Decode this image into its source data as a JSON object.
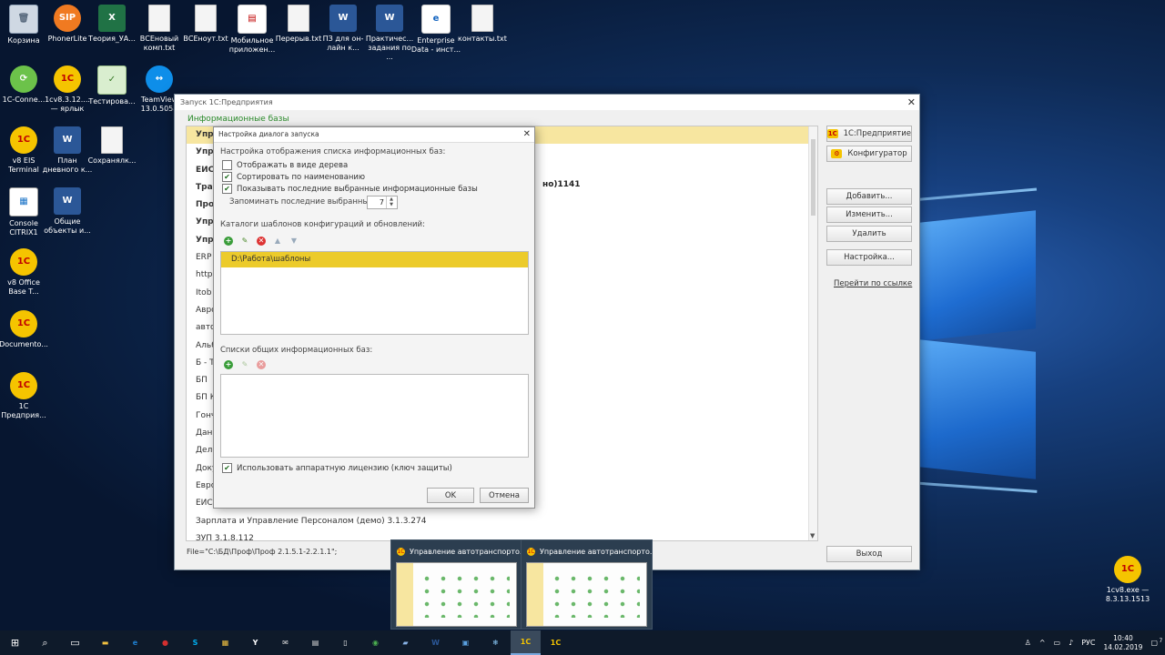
{
  "desktop": {
    "icons": [
      {
        "label": "Корзина",
        "icon": "recycle-bin-icon",
        "glyph": "🗑"
      },
      {
        "label": "PhonerLite",
        "icon": "phonerlite-icon",
        "glyph": "SIP"
      },
      {
        "label": "Теория_УА...",
        "icon": "excel-file-icon",
        "glyph": "X"
      },
      {
        "label": "ВСЕновый комп.txt",
        "icon": "text-file-icon",
        "glyph": ""
      },
      {
        "label": "ВСЕноут.txt",
        "icon": "text-file-icon",
        "glyph": ""
      },
      {
        "label": "Мобильное приложен...",
        "icon": "mobile-app-file-icon",
        "glyph": "▤"
      },
      {
        "label": "Перерыв.txt",
        "icon": "text-file-icon",
        "glyph": ""
      },
      {
        "label": "ПЗ для он-лайн к...",
        "icon": "word-file-icon",
        "glyph": "W"
      },
      {
        "label": "Практичес... задания по ...",
        "icon": "word-file-icon",
        "glyph": "W"
      },
      {
        "label": "Enterprise Data - инст...",
        "icon": "pdf-file-icon",
        "glyph": "e"
      },
      {
        "label": "контакты.txt",
        "icon": "text-file-icon",
        "glyph": ""
      },
      {
        "label": "1C-Conne...",
        "icon": "1c-connect-icon",
        "glyph": "⟳"
      },
      {
        "label": "1cv8.3.12.... — ярлык",
        "icon": "1c-icon",
        "glyph": "1С"
      },
      {
        "label": "Тестирова...",
        "icon": "test-file-icon",
        "glyph": "✓"
      },
      {
        "label": "TeamView 13.0.5058",
        "icon": "teamviewer-icon",
        "glyph": "↔"
      },
      {
        "label": "v8 EIS Terminal",
        "icon": "1c-icon",
        "glyph": "1С"
      },
      {
        "label": "План дневного к...",
        "icon": "word-file-icon",
        "glyph": "W"
      },
      {
        "label": "Сохранялк...",
        "icon": "text-file-icon",
        "glyph": ""
      },
      {
        "label": "Console CITRIX1",
        "icon": "citrix-console-icon",
        "glyph": "▦"
      },
      {
        "label": "Общие объекты и...",
        "icon": "word-file-icon",
        "glyph": "W"
      },
      {
        "label": "v8 Office Base T...",
        "icon": "1c-icon",
        "glyph": "1С"
      },
      {
        "label": "Documento...",
        "icon": "1c-icon",
        "glyph": "1С"
      },
      {
        "label": "1С Предприя...",
        "icon": "1c-icon",
        "glyph": "1С"
      },
      {
        "label": "1cv8.exe — 8.3.13.1513",
        "icon": "1c-icon",
        "glyph": "1С"
      }
    ]
  },
  "main_window": {
    "title": "Запуск 1С:Предприятия",
    "section_label": "Информационные базы",
    "list_items": [
      "Упра",
      "Упра",
      "ЕИС",
      "Тран",
      "Прое",
      "Упра",
      "Упра",
      "ERP",
      "http:",
      "Itob",
      "Авро",
      "авто",
      "Альб",
      "Б - Т",
      "БП",
      "БП К",
      "Гонч",
      "Данн",
      "Деле",
      "Доку",
      "Евро",
      "ЕИС",
      "Зарплата и Управление Персоналом (демо) 3.1.3.274",
      "ЗУП 3.1.8.112"
    ],
    "visible_fragment": "но)1141",
    "file_path": "File=\"C:\\БД\\Проф\\Проф 2.1.5.1-2.2.1.1\";",
    "buttons": {
      "enterprise": "1С:Предприятие",
      "configurator": "Конфигуратор",
      "add": "Добавить...",
      "edit": "Изменить...",
      "delete": "Удалить",
      "settings": "Настройка...",
      "exit": "Выход"
    },
    "link": "Перейти по ссылке"
  },
  "dialog": {
    "title": "Настройка диалога запуска",
    "display_heading": "Настройка отображения списка информационных баз:",
    "options": {
      "tree": {
        "label": "Отображать в виде дерева",
        "checked": false
      },
      "sort": {
        "label": "Сортировать по наименованию",
        "checked": true
      },
      "recent": {
        "label": "Показывать последние выбранные информационные базы",
        "checked": true
      }
    },
    "remember_label": "Запоминать последние выбранные:",
    "remember_value": "7",
    "templates_heading": "Каталоги шаблонов конфигураций и обновлений:",
    "templates_path": "D:\\Работа\\шаблоны",
    "common_heading": "Списки общих информационных баз:",
    "hardware_license": {
      "label": "Использовать аппаратную лицензию (ключ защиты)",
      "checked": true
    },
    "ok": "OK",
    "cancel": "Отмена"
  },
  "taskbar_previews": [
    {
      "title": "Управление автотранспорто..."
    },
    {
      "title": "Управление автотранспорто..."
    }
  ],
  "taskbar": {
    "apps": [
      {
        "name": "file-explorer",
        "glyph": "▬",
        "color": "#f0c040"
      },
      {
        "name": "edge",
        "glyph": "e",
        "color": "#1f7fd0"
      },
      {
        "name": "record",
        "glyph": "●",
        "color": "#d32f2f"
      },
      {
        "name": "skype",
        "glyph": "S",
        "color": "#00aff0"
      },
      {
        "name": "store",
        "glyph": "▦",
        "color": "#f0c040"
      },
      {
        "name": "yandex",
        "glyph": "Y",
        "color": "#ffffff"
      },
      {
        "name": "mail",
        "glyph": "✉",
        "color": "#dddddd"
      },
      {
        "name": "calculator",
        "glyph": "▤",
        "color": "#dddddd"
      },
      {
        "name": "notepad",
        "glyph": "▯",
        "color": "#eeeeee"
      },
      {
        "name": "chrome",
        "glyph": "◉",
        "color": "#4caf50"
      },
      {
        "name": "notes",
        "glyph": "▰",
        "color": "#89b4e8"
      },
      {
        "name": "word",
        "glyph": "W",
        "color": "#2b5797"
      },
      {
        "name": "remote",
        "glyph": "▣",
        "color": "#5aa0e0"
      },
      {
        "name": "settings",
        "glyph": "❄",
        "color": "#8fd0ff"
      },
      {
        "name": "1c-active",
        "glyph": "1С",
        "color": "#f5c400"
      },
      {
        "name": "1c",
        "glyph": "1С",
        "color": "#f5c400"
      }
    ],
    "tray": {
      "language": "РУС",
      "time": "10:40",
      "date": "14.02.2019",
      "notifications": "7"
    }
  }
}
